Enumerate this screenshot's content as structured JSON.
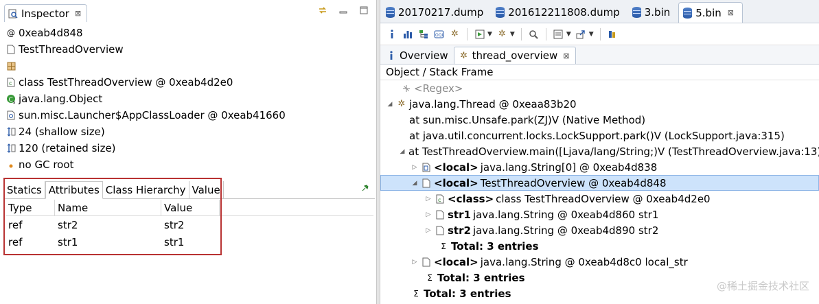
{
  "inspector": {
    "title": "Inspector",
    "close": "⊠",
    "properties": [
      {
        "icon": "at-icon",
        "glyph": "@",
        "text": "0xeab4d848"
      },
      {
        "icon": "class-file-icon",
        "glyph": "",
        "text": "TestThreadOverview"
      },
      {
        "icon": "package-icon",
        "glyph": "",
        "text": ""
      },
      {
        "icon": "class-icon",
        "glyph": "",
        "text": "class TestThreadOverview @ 0xeab4d2e0"
      },
      {
        "icon": "superclass-icon",
        "glyph": "",
        "text": "java.lang.Object"
      },
      {
        "icon": "classloader-icon",
        "glyph": "",
        "text": "sun.misc.Launcher$AppClassLoader @ 0xeab41660"
      },
      {
        "icon": "size-icon",
        "glyph": "",
        "text": "24 (shallow size)"
      },
      {
        "icon": "size-icon",
        "glyph": "",
        "text": "120 (retained size)"
      },
      {
        "icon": "gc-root-icon",
        "glyph": "",
        "text": "no GC root"
      }
    ],
    "subtabs": [
      "Statics",
      "Attributes",
      "Class Hierarchy",
      "Value"
    ],
    "active_subtab": "Attributes",
    "attributes": {
      "headers": [
        "Type",
        "Name",
        "Value"
      ],
      "rows": [
        [
          "ref",
          "str2",
          "str2"
        ],
        [
          "ref",
          "str1",
          "str1"
        ]
      ]
    }
  },
  "editor": {
    "tabs": [
      "20170217.dump",
      "201612211808.dump",
      "3.bin",
      "5.bin"
    ],
    "active_tab": "5.bin",
    "close": "⊠",
    "inner_tabs": [
      "Overview",
      "thread_overview"
    ],
    "active_inner": "thread_overview",
    "tree_header": "Object / Stack Frame",
    "regex": "<Regex>",
    "tree": {
      "thread": "java.lang.Thread @ 0xeaa83b20",
      "frame1": "at sun.misc.Unsafe.park(ZJ)V (Native Method)",
      "frame2": "at java.util.concurrent.locks.LockSupport.park()V (LockSupport.java:315)",
      "frame3": "at TestThreadOverview.main([Ljava/lang/String;)V (TestThreadOverview.java:13)",
      "local_tag": "<local>",
      "class_tag": "<class>",
      "local1": "java.lang.String[0] @ 0xeab4d838",
      "local2": "TestThreadOverview @ 0xeab4d848",
      "cls": "class TestThreadOverview @ 0xeab4d2e0",
      "str1_name": "str1",
      "str1_val": "java.lang.String @ 0xeab4d860  str1",
      "str2_name": "str2",
      "str2_val": "java.lang.String @ 0xeab4d890  str2",
      "total_inner": "Total: 3 entries",
      "local3": "java.lang.String @ 0xeab4d8c0  local_str",
      "total_frame": "Total: 3 entries",
      "total_thread": "Total: 3 entries"
    }
  },
  "watermark": "@稀土掘金技术社区"
}
